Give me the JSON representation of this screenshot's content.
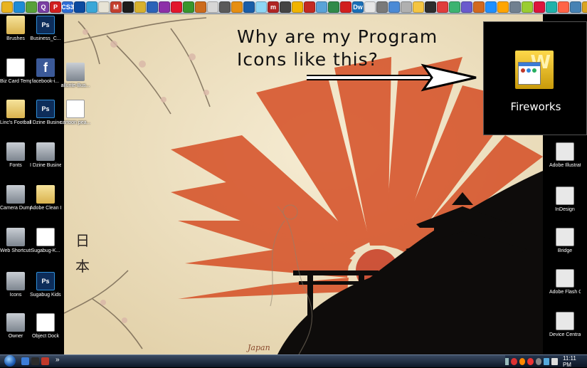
{
  "dock": {
    "colors": [
      "#e9b320",
      "#1e8bd6",
      "#58a13a",
      "#7a3fa3",
      "#d11f1f",
      "#2f6fd6",
      "#0b4aa0",
      "#3aa7d8",
      "#e7e3d5",
      "#c43f2f",
      "#1c1c1c",
      "#d8b12e",
      "#2b63b8",
      "#8c2fa8",
      "#e2162c",
      "#38962c",
      "#cc6b1d",
      "#d6d6d6",
      "#5a5a5a",
      "#e68f12",
      "#195da8",
      "#8fd6f5",
      "#b02424",
      "#444",
      "#f0b400",
      "#c42a22",
      "#5aa3d8",
      "#2f8a4a",
      "#d11f1f",
      "#1a6fb8",
      "#e6e6e6",
      "#7a7a7a",
      "#4b8ad6",
      "#b0b0b0",
      "#f4c542",
      "#2d2d2d",
      "#e03c3c",
      "#3cb371",
      "#6a5acd",
      "#d2691e",
      "#1e90ff",
      "#ffa500",
      "#708090",
      "#9acd32",
      "#dc143c",
      "#20b2aa",
      "#ff6347",
      "#4682b4",
      "#daa520",
      "#8b4513"
    ],
    "labels": [
      "",
      "",
      "",
      "Q",
      "P",
      "CS3",
      "",
      "",
      "",
      "M",
      "",
      "",
      "",
      "",
      "",
      "",
      "",
      "",
      "",
      "",
      "",
      "",
      "m",
      "",
      "",
      "",
      "",
      "",
      "",
      "Dw",
      "",
      "",
      "",
      "",
      "",
      "",
      "",
      "",
      "",
      "",
      "",
      "",
      "",
      "",
      "",
      "",
      "",
      "",
      "",
      ""
    ]
  },
  "left_icons": [
    {
      "label": "Brushes",
      "kind": "folder",
      "glyph": ""
    },
    {
      "label": "Business_C...",
      "kind": "ps",
      "glyph": "Ps"
    },
    {
      "label": "Biz Card Templat...",
      "kind": "doc",
      "glyph": ""
    },
    {
      "label": "facebook-i...",
      "kind": "fb",
      "glyph": "f"
    },
    {
      "label": "Linc's Football Pi...",
      "kind": "folder",
      "glyph": ""
    },
    {
      "label": "I Dzine Business_C...",
      "kind": "ps",
      "glyph": "Ps"
    },
    {
      "label": "Fonts",
      "kind": "gray",
      "glyph": ""
    },
    {
      "label": "I Dzine Business_C...",
      "kind": "gray",
      "glyph": ""
    },
    {
      "label": "Camera Dump",
      "kind": "gray",
      "glyph": ""
    },
    {
      "label": "Adobe Clean Install & Er...",
      "kind": "folder",
      "glyph": ""
    },
    {
      "label": "Web Shortcuts",
      "kind": "gray",
      "glyph": ""
    },
    {
      "label": "Sugabug-K...",
      "kind": "doc",
      "glyph": ""
    },
    {
      "label": "Icons",
      "kind": "gray",
      "glyph": ""
    },
    {
      "label": "Sugabug Kids Logo",
      "kind": "ps",
      "glyph": "Ps"
    },
    {
      "label": "Owner",
      "kind": "gray",
      "glyph": ""
    },
    {
      "label": "Object Dock",
      "kind": "doc",
      "glyph": ""
    }
  ],
  "wall_icons": [
    {
      "label": "allurite-Bus...",
      "kind": "gray",
      "glyph": ""
    },
    {
      "label": "cartoon pea...",
      "kind": "doc",
      "glyph": ""
    }
  ],
  "right_icons": [
    {
      "label": "Adobe Illustrat...",
      "kind": "adobe-small",
      "glyph": ""
    },
    {
      "label": "InDesign",
      "kind": "adobe-small",
      "glyph": ""
    },
    {
      "label": "Bridge",
      "kind": "adobe-small",
      "glyph": ""
    },
    {
      "label": "Adobe Flash Catalyst",
      "kind": "adobe-small",
      "glyph": ""
    },
    {
      "label": "Device Central",
      "kind": "adobe-small",
      "glyph": ""
    }
  ],
  "callout": {
    "question_line1": "Why are my Program",
    "question_line2": "Icons like this?",
    "icon_label": "Fireworks",
    "icon_letter": "W"
  },
  "wallpaper": {
    "kanji_1": "日",
    "kanji_2": "本",
    "watermark": "Japan"
  },
  "taskbar": {
    "clock": "11:11 PM",
    "expand": "»"
  }
}
